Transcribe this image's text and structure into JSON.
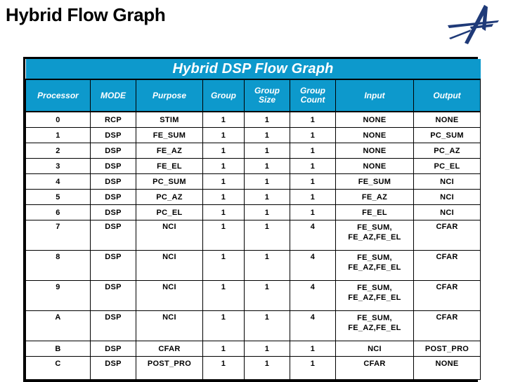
{
  "slide": {
    "title": "Hybrid Flow Graph",
    "logo_icon": "lockheed-star-logo-icon",
    "logo_color": "#1f3a78",
    "background_color": "#ffffff"
  },
  "table": {
    "banner": "Hybrid DSP Flow Graph",
    "accent_color": "#0d99cc",
    "header_text_color": "#ffffff",
    "border_color": "#000000",
    "columns": [
      "Processor",
      "MODE",
      "Purpose",
      "Group",
      "Group Size",
      "Group Count",
      "Input",
      "Output"
    ],
    "columns_split": [
      {
        "line1": "Processor",
        "line2": ""
      },
      {
        "line1": "MODE",
        "line2": ""
      },
      {
        "line1": "Purpose",
        "line2": ""
      },
      {
        "line1": "Group",
        "line2": ""
      },
      {
        "line1": "Group",
        "line2": "Size"
      },
      {
        "line1": "Group",
        "line2": "Count"
      },
      {
        "line1": "Input",
        "line2": ""
      },
      {
        "line1": "Output",
        "line2": ""
      }
    ],
    "rows": [
      {
        "processor": "0",
        "mode": "RCP",
        "purpose": "STIM",
        "group": "1",
        "group_size": "1",
        "group_count": "1",
        "input_line1": "NONE",
        "input_line2": "",
        "output": "NONE"
      },
      {
        "processor": "1",
        "mode": "DSP",
        "purpose": "FE_SUM",
        "group": "1",
        "group_size": "1",
        "group_count": "1",
        "input_line1": "NONE",
        "input_line2": "",
        "output": "PC_SUM"
      },
      {
        "processor": "2",
        "mode": "DSP",
        "purpose": "FE_AZ",
        "group": "1",
        "group_size": "1",
        "group_count": "1",
        "input_line1": "NONE",
        "input_line2": "",
        "output": "PC_AZ"
      },
      {
        "processor": "3",
        "mode": "DSP",
        "purpose": "FE_EL",
        "group": "1",
        "group_size": "1",
        "group_count": "1",
        "input_line1": "NONE",
        "input_line2": "",
        "output": "PC_EL"
      },
      {
        "processor": "4",
        "mode": "DSP",
        "purpose": "PC_SUM",
        "group": "1",
        "group_size": "1",
        "group_count": "1",
        "input_line1": "FE_SUM",
        "input_line2": "",
        "output": "NCI"
      },
      {
        "processor": "5",
        "mode": "DSP",
        "purpose": "PC_AZ",
        "group": "1",
        "group_size": "1",
        "group_count": "1",
        "input_line1": "FE_AZ",
        "input_line2": "",
        "output": "NCI"
      },
      {
        "processor": "6",
        "mode": "DSP",
        "purpose": "PC_EL",
        "group": "1",
        "group_size": "1",
        "group_count": "1",
        "input_line1": "FE_EL",
        "input_line2": "",
        "output": "NCI"
      },
      {
        "processor": "7",
        "mode": "DSP",
        "purpose": "NCI",
        "group": "1",
        "group_size": "1",
        "group_count": "4",
        "input_line1": "FE_SUM,",
        "input_line2": "FE_AZ,FE_EL",
        "output": "CFAR"
      },
      {
        "processor": "8",
        "mode": "DSP",
        "purpose": "NCI",
        "group": "1",
        "group_size": "1",
        "group_count": "4",
        "input_line1": "FE_SUM,",
        "input_line2": "FE_AZ,FE_EL",
        "output": "CFAR"
      },
      {
        "processor": "9",
        "mode": "DSP",
        "purpose": "NCI",
        "group": "1",
        "group_size": "1",
        "group_count": "4",
        "input_line1": "FE_SUM,",
        "input_line2": "FE_AZ,FE_EL",
        "output": "CFAR"
      },
      {
        "processor": "A",
        "mode": "DSP",
        "purpose": "NCI",
        "group": "1",
        "group_size": "1",
        "group_count": "4",
        "input_line1": "FE_SUM,",
        "input_line2": "FE_AZ,FE_EL",
        "output": "CFAR"
      },
      {
        "processor": "B",
        "mode": "DSP",
        "purpose": "CFAR",
        "group": "1",
        "group_size": "1",
        "group_count": "1",
        "input_line1": "NCI",
        "input_line2": "",
        "output": "POST_PRO"
      },
      {
        "processor": "C",
        "mode": "DSP",
        "purpose": "POST_PRO",
        "group": "1",
        "group_size": "1",
        "group_count": "1",
        "input_line1": "CFAR",
        "input_line2": "",
        "output": "NONE"
      }
    ]
  }
}
